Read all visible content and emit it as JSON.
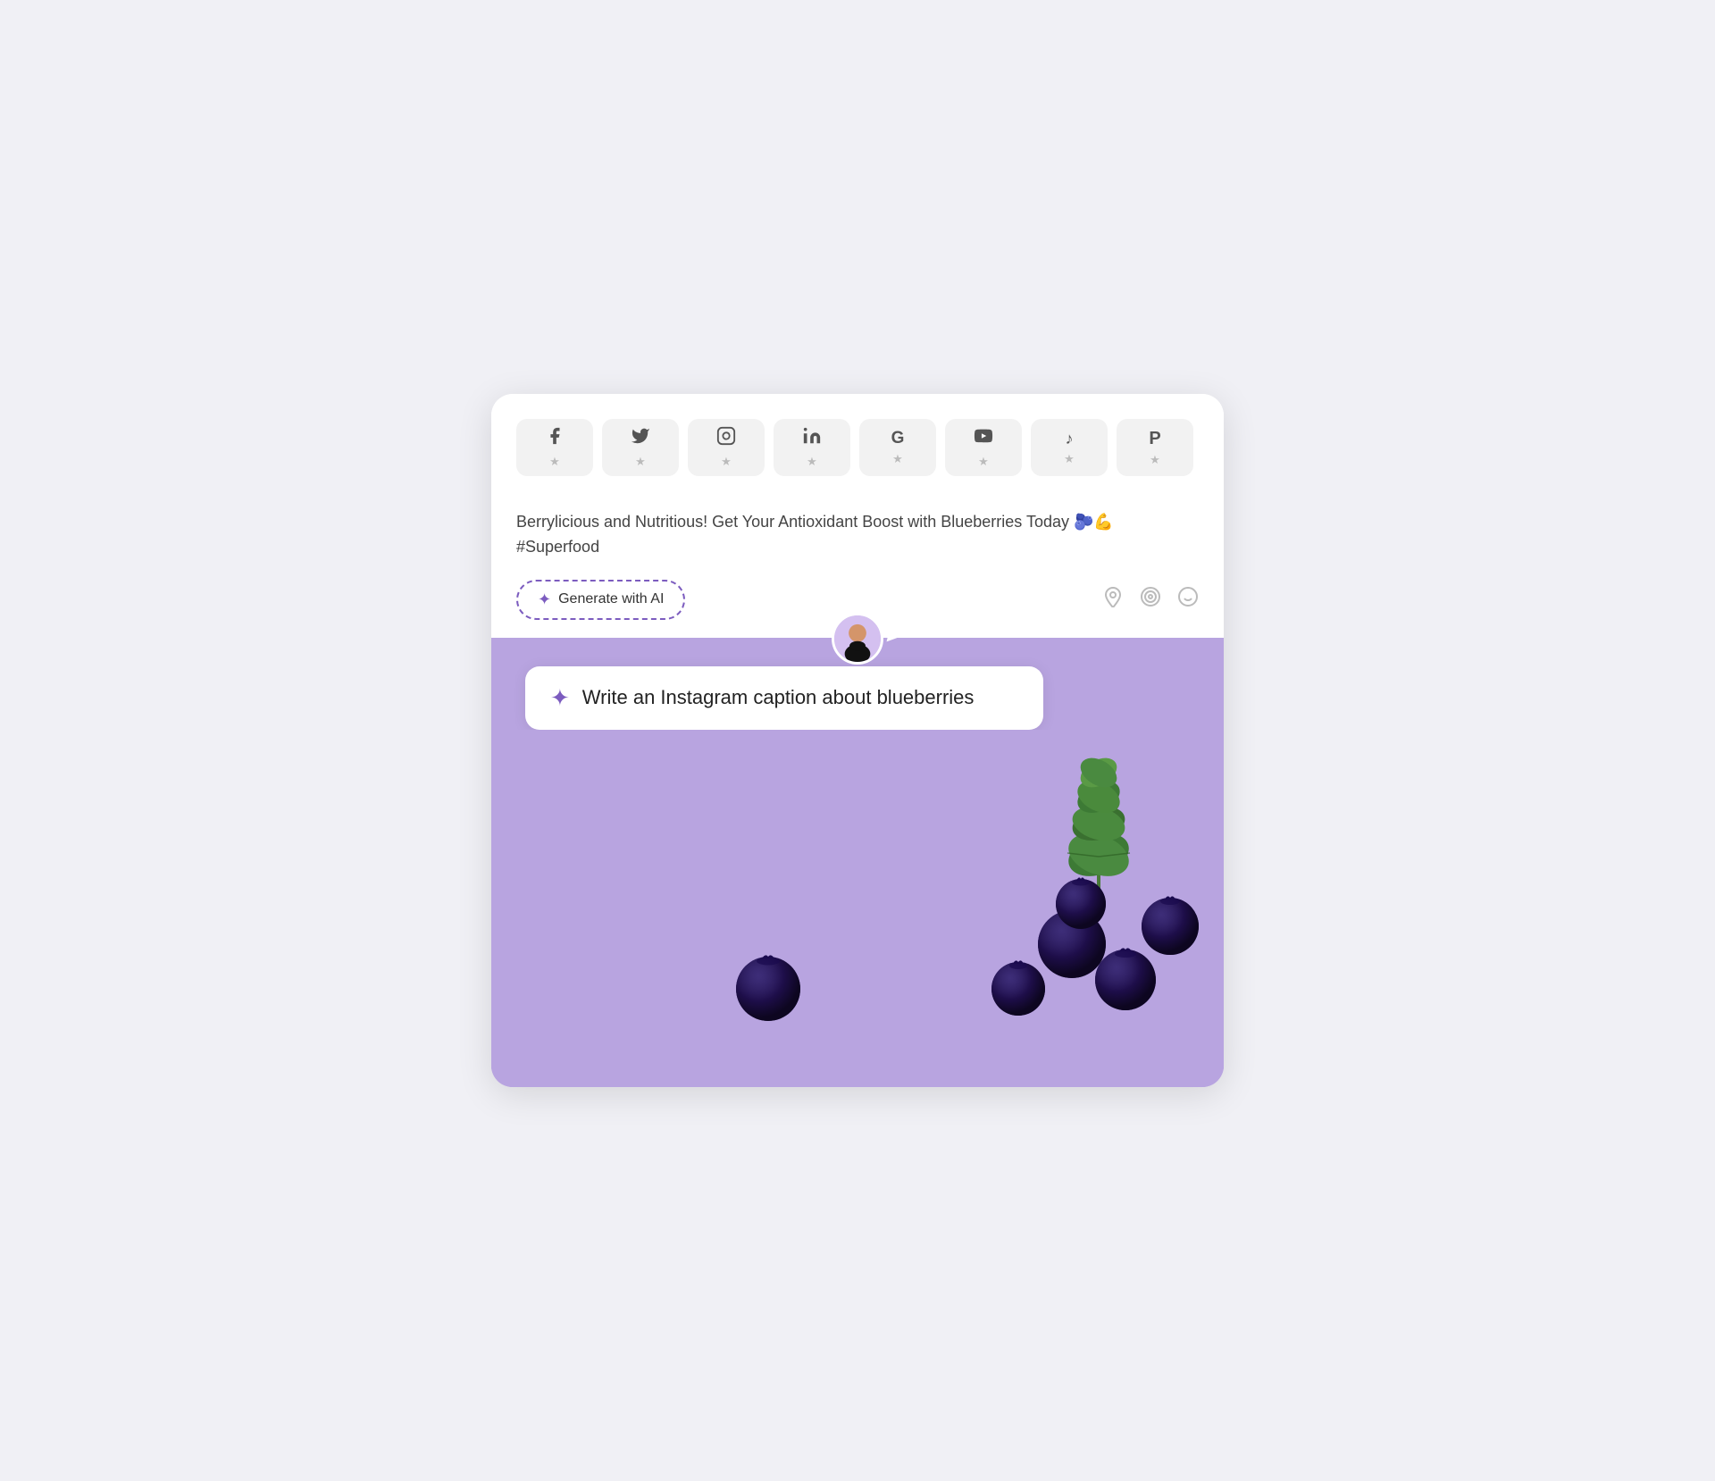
{
  "social": {
    "platforms": [
      {
        "name": "facebook",
        "icon": "𝔣",
        "unicode": "f",
        "label": "Facebook"
      },
      {
        "name": "twitter",
        "icon": "𝕏",
        "label": "Twitter"
      },
      {
        "name": "instagram",
        "icon": "📷",
        "label": "Instagram"
      },
      {
        "name": "linkedin",
        "icon": "in",
        "label": "LinkedIn"
      },
      {
        "name": "google",
        "icon": "G",
        "label": "Google"
      },
      {
        "name": "youtube",
        "icon": "▶",
        "label": "YouTube"
      },
      {
        "name": "tiktok",
        "icon": "♪",
        "label": "TikTok"
      },
      {
        "name": "pinterest",
        "icon": "P",
        "label": "Pinterest"
      }
    ],
    "star_label": "★"
  },
  "caption": {
    "text": "Berrylicious and Nutritious! Get Your Antioxidant Boost with Blueberries Today 🫐💪 #Superfood"
  },
  "generate_button": {
    "label": "Generate with AI",
    "sparkle": "✦"
  },
  "ai_prompt": {
    "text": "Write an Instagram caption about blueberries",
    "sparkle": "✦"
  },
  "action_icons": {
    "location": "◎",
    "target": "◎",
    "emoji": "☺"
  }
}
